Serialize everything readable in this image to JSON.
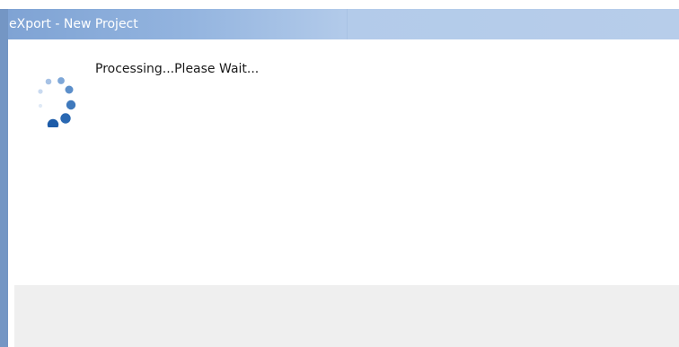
{
  "window": {
    "title": "eXport - New Project"
  },
  "main": {
    "status_text": "Processing...Please Wait...",
    "spinner_icon": "loading-spinner-icon"
  },
  "colors": {
    "titlebar": "#7fa3d4",
    "spinner": "#1f5ea8",
    "footer": "#efefef"
  }
}
